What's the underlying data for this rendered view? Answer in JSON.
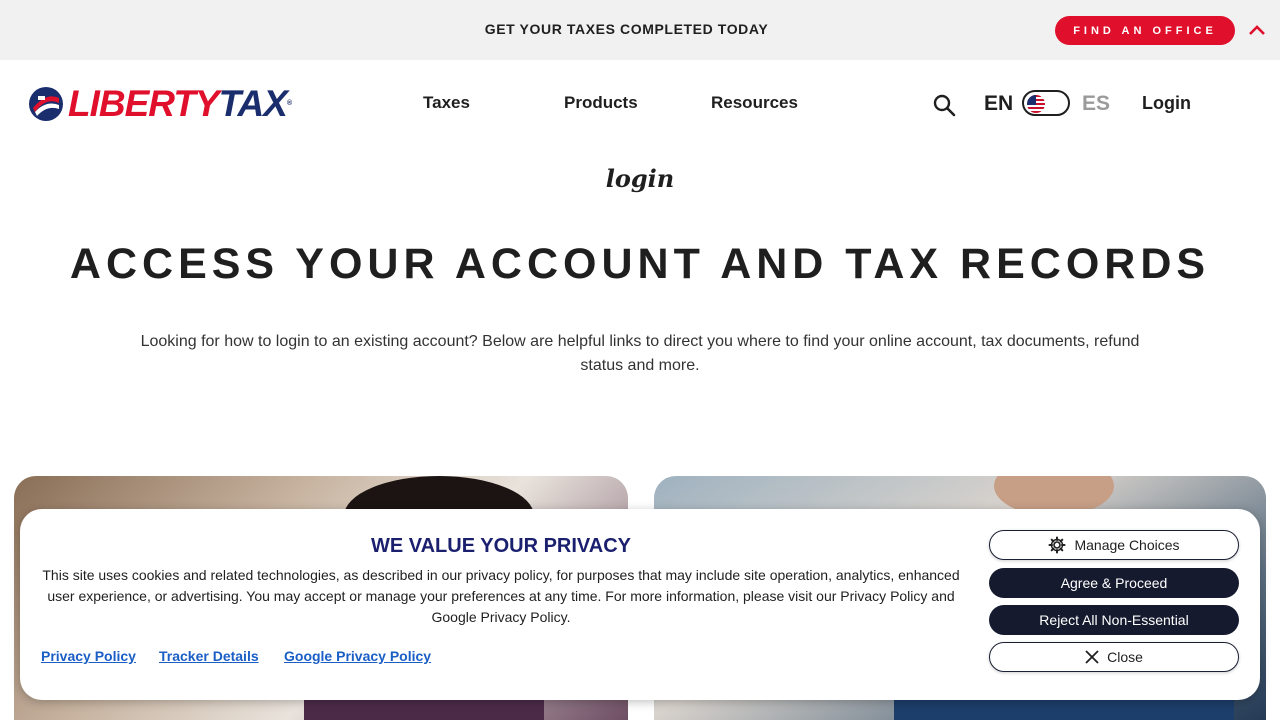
{
  "promo_bar": {
    "text": "GET YOUR TAXES COMPLETED TODAY",
    "find_office_label": "FIND AN OFFICE",
    "collapse_icon": "chevron-up-icon",
    "accent": "#e0102c"
  },
  "header": {
    "logo": {
      "liberty": "LIBERTY",
      "tax": "TAX",
      "reg": "®"
    },
    "nav_items": [
      {
        "label": "Taxes"
      },
      {
        "label": "Products"
      },
      {
        "label": "Resources"
      }
    ],
    "search_icon": "search-icon",
    "lang_en": "EN",
    "lang_es": "ES",
    "login_label": "Login"
  },
  "hero": {
    "eyebrow": "login",
    "title": "ACCESS YOUR ACCOUNT AND TAX RECORDS",
    "description": "Looking for how to login to an existing account? Below are helpful links to direct you where to find your online account, tax documents, refund status and more."
  },
  "privacy": {
    "title": "WE VALUE YOUR PRIVACY",
    "body": "This site uses cookies and related technologies, as described in our privacy policy, for purposes that may include site operation, analytics, enhanced user experience, or advertising. You may accept or manage your preferences at any time. For more information, please visit our Privacy Policy and Google Privacy Policy.",
    "links": [
      {
        "label": "Privacy Policy"
      },
      {
        "label": "Tracker Details"
      },
      {
        "label": "Google Privacy Policy"
      }
    ],
    "manage_label": "Manage Choices",
    "agree_label": "Agree & Proceed",
    "reject_label": "Reject All Non-Essential",
    "close_label": "Close",
    "title_color": "#1a1f6e",
    "link_color": "#1a5ec6"
  }
}
